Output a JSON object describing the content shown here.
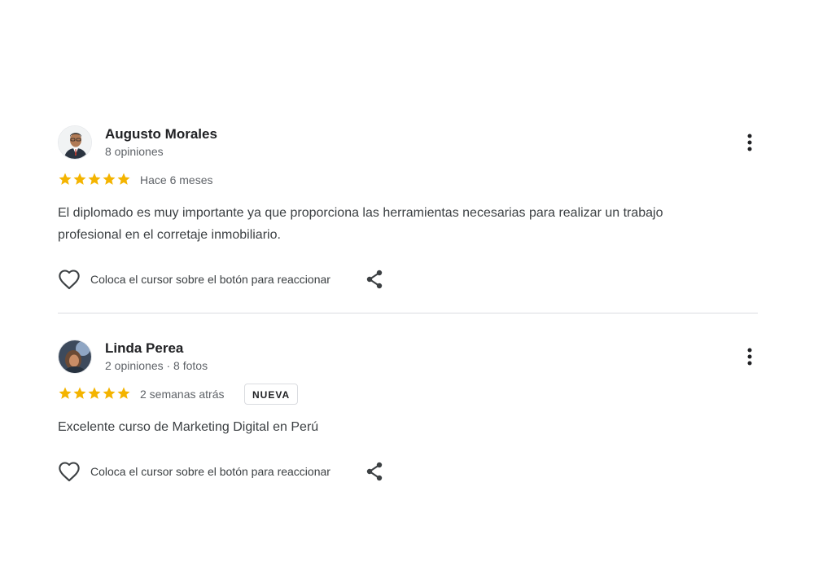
{
  "reviews": [
    {
      "author": "Augusto Morales",
      "meta": "8 opiniones",
      "rating": 5,
      "time": "Hace 6 meses",
      "badge": "",
      "text_line1": "El diplomado es muy importante ya que proporciona las herramientas necesarias para realizar un trabajo",
      "text_line2": "profesional en el corretaje inmobiliario.",
      "react_hint": "Coloca el cursor sobre el botón para reaccionar"
    },
    {
      "author": "Linda Perea",
      "meta": "2 opiniones · 8 fotos",
      "rating": 5,
      "time": "2 semanas atrás",
      "badge": "NUEVA",
      "text": "Excelente curso de Marketing Digital en Perú",
      "react_hint": "Coloca el cursor sobre el botón para reaccionar"
    }
  ],
  "icons": {
    "star": "star-icon",
    "more": "more-vert-icon",
    "heart": "heart-outline-icon",
    "share": "share-icon"
  },
  "colors": {
    "star": "#f4b400",
    "name": "#202124",
    "secondary": "#5f6368",
    "body": "#3c4043",
    "divider": "#dadce0"
  }
}
